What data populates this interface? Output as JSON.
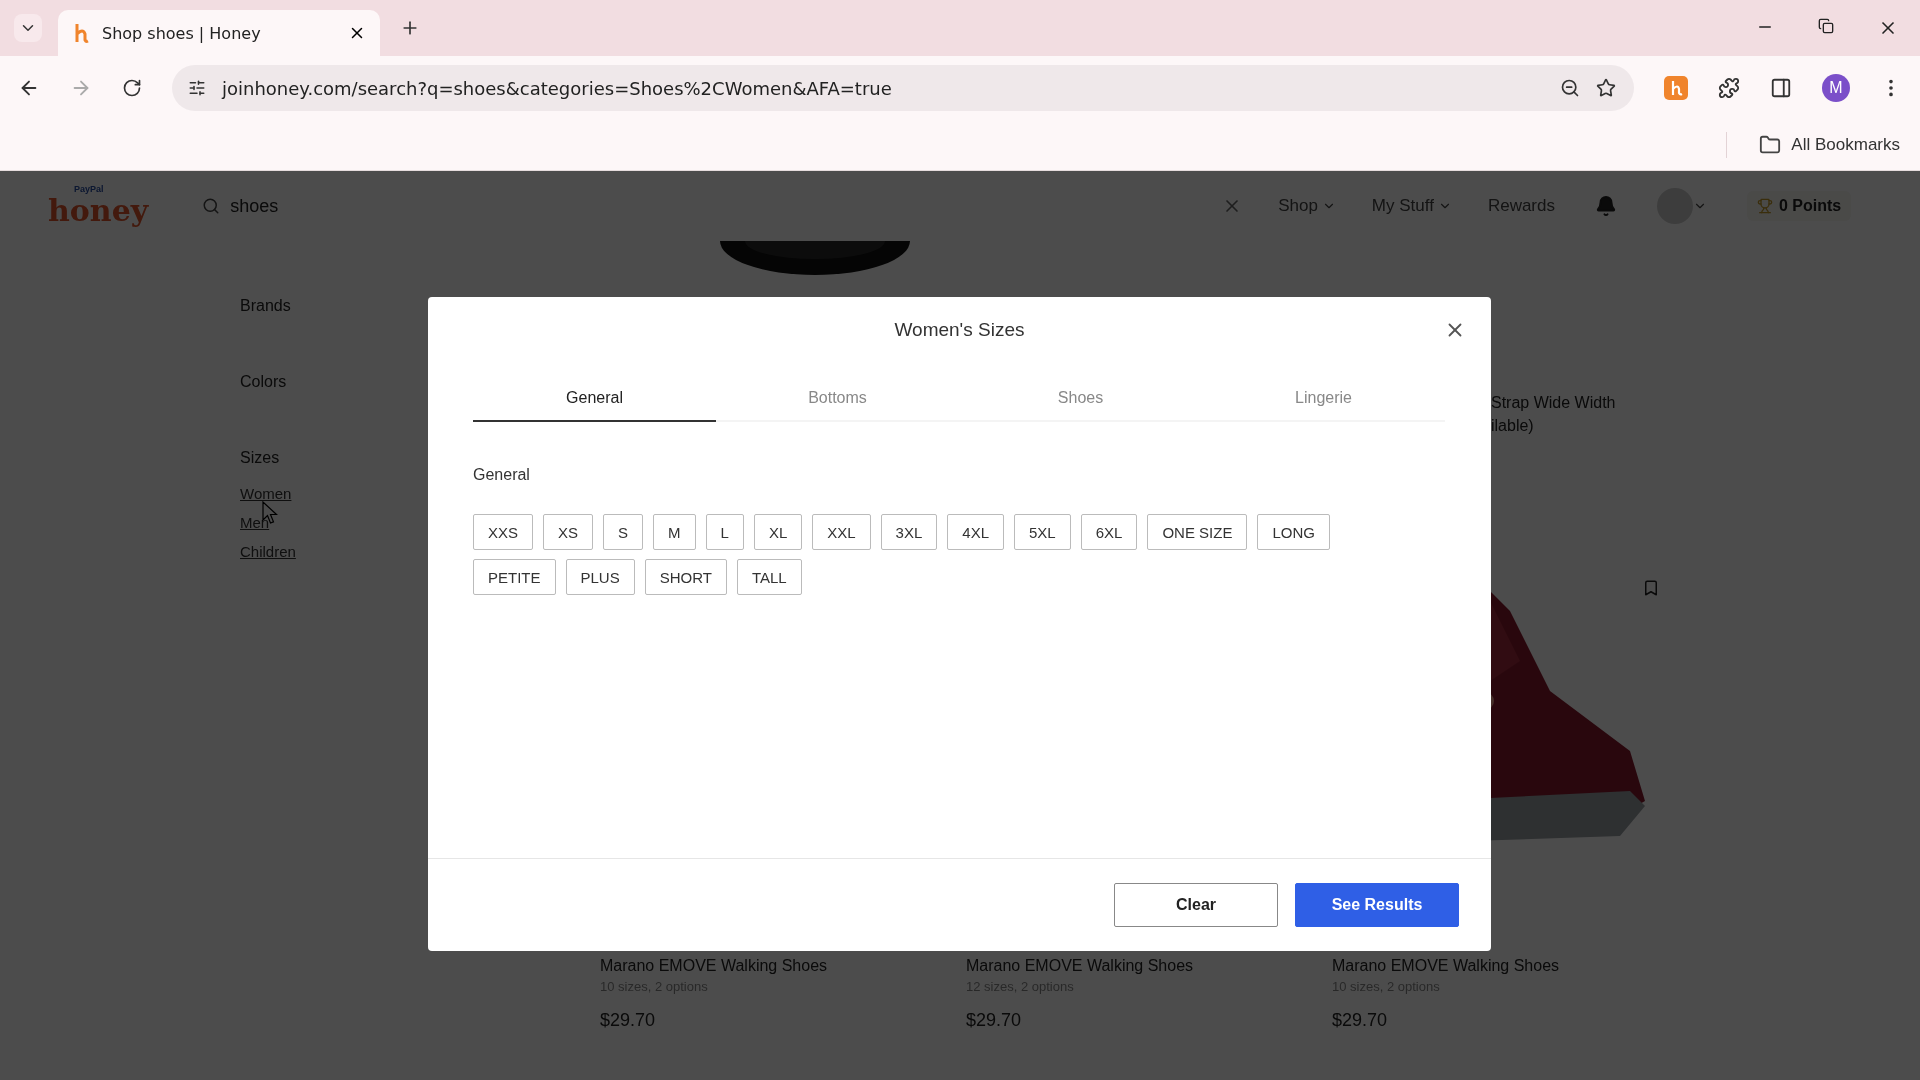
{
  "browser": {
    "tab_title": "Shop shoes | Honey",
    "url": "joinhoney.com/search?q=shoes&categories=Shoes%2CWomen&AFA=true",
    "profile_initial": "M",
    "bookmarks_label": "All Bookmarks"
  },
  "header": {
    "logo_small": "PayPal",
    "logo_main": "honey",
    "search_value": "shoes",
    "nav": [
      "Shop",
      "My Stuff"
    ],
    "rewards": "Rewards",
    "points": "0 Points"
  },
  "sidebar": {
    "sections": [
      "Brands",
      "Colors",
      "Sizes"
    ],
    "size_links": [
      "Women",
      "Men",
      "Children"
    ]
  },
  "products_top": {
    "title_lines": [
      "Strap Wide Width",
      "ilable)"
    ]
  },
  "products": [
    {
      "title": "Marano EMOVE Walking Shoes",
      "subtitle": "10 sizes, 2 options",
      "price": "$29.70"
    },
    {
      "title": "Marano EMOVE Walking Shoes",
      "subtitle": "12 sizes, 2 options",
      "price": "$29.70"
    },
    {
      "title": "Marano EMOVE Walking Shoes",
      "subtitle": "10 sizes, 2 options",
      "price": "$29.70"
    }
  ],
  "modal": {
    "title": "Women's Sizes",
    "tabs": [
      {
        "label": "General",
        "selected": true
      },
      {
        "label": "Bottoms",
        "selected": false
      },
      {
        "label": "Shoes",
        "selected": false
      },
      {
        "label": "Lingerie",
        "selected": false
      }
    ],
    "group_label": "General",
    "sizes": [
      [
        "XXS",
        "XS",
        "S",
        "M",
        "L",
        "XL",
        "XXL",
        "3XL",
        "4XL",
        "5XL",
        "6XL",
        "ONE SIZE",
        "LONG"
      ],
      [
        "PETITE",
        "PLUS",
        "SHORT",
        "TALL"
      ]
    ],
    "clear": "Clear",
    "submit": "See Results"
  }
}
